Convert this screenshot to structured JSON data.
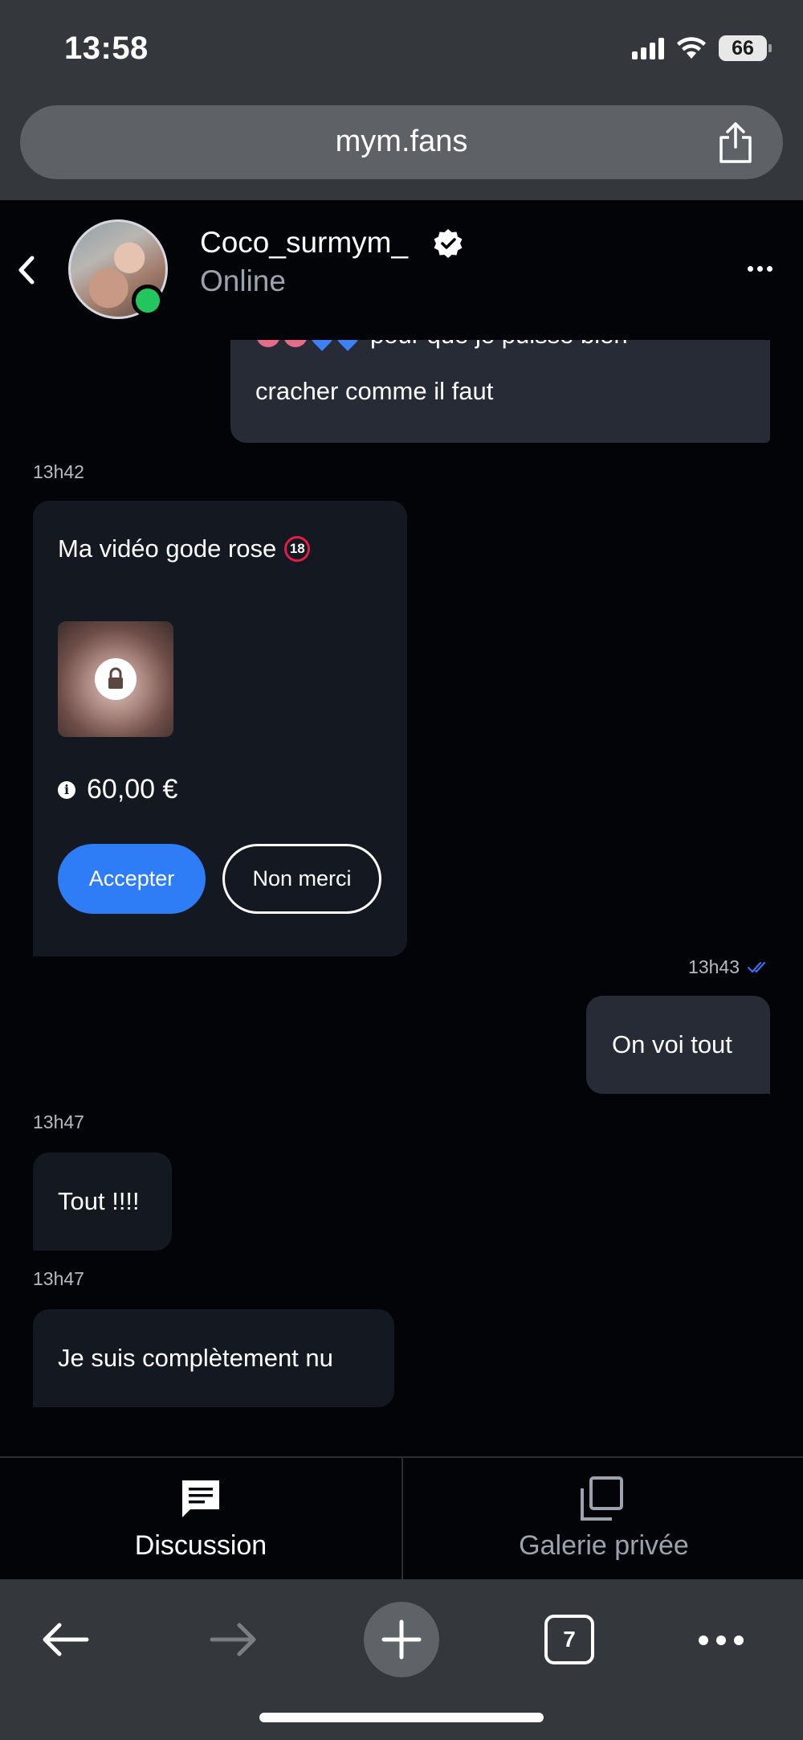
{
  "status_bar": {
    "time": "13:58",
    "battery": "66"
  },
  "browser": {
    "url": "mym.fans",
    "tab_count": "7"
  },
  "header": {
    "name": "Coco_surmym_",
    "status": "Online"
  },
  "messages": {
    "m1": {
      "partial_top": "pour que je puisse bien",
      "text": "cracher comme il faut"
    },
    "m2": {
      "time": "13h42",
      "title": "Ma vidéo gode rose",
      "badge": "🔞",
      "price": "60,00 €",
      "accept_label": "Accepter",
      "decline_label": "Non merci"
    },
    "m3": {
      "time": "13h43",
      "text": "On voi tout"
    },
    "m4": {
      "time": "13h47",
      "text": "Tout !!!!"
    },
    "m5": {
      "time": "13h47",
      "text": "Je suis complètement nu"
    }
  },
  "tabs": [
    {
      "label": "Discussion",
      "active": true
    },
    {
      "label": "Galerie privée",
      "active": false
    }
  ],
  "colors": {
    "accent": "#2e7cf6",
    "online": "#22c55e",
    "bubble_out": "#262b36",
    "bubble_in": "#131821",
    "read_receipt": "#3b6cf0"
  }
}
